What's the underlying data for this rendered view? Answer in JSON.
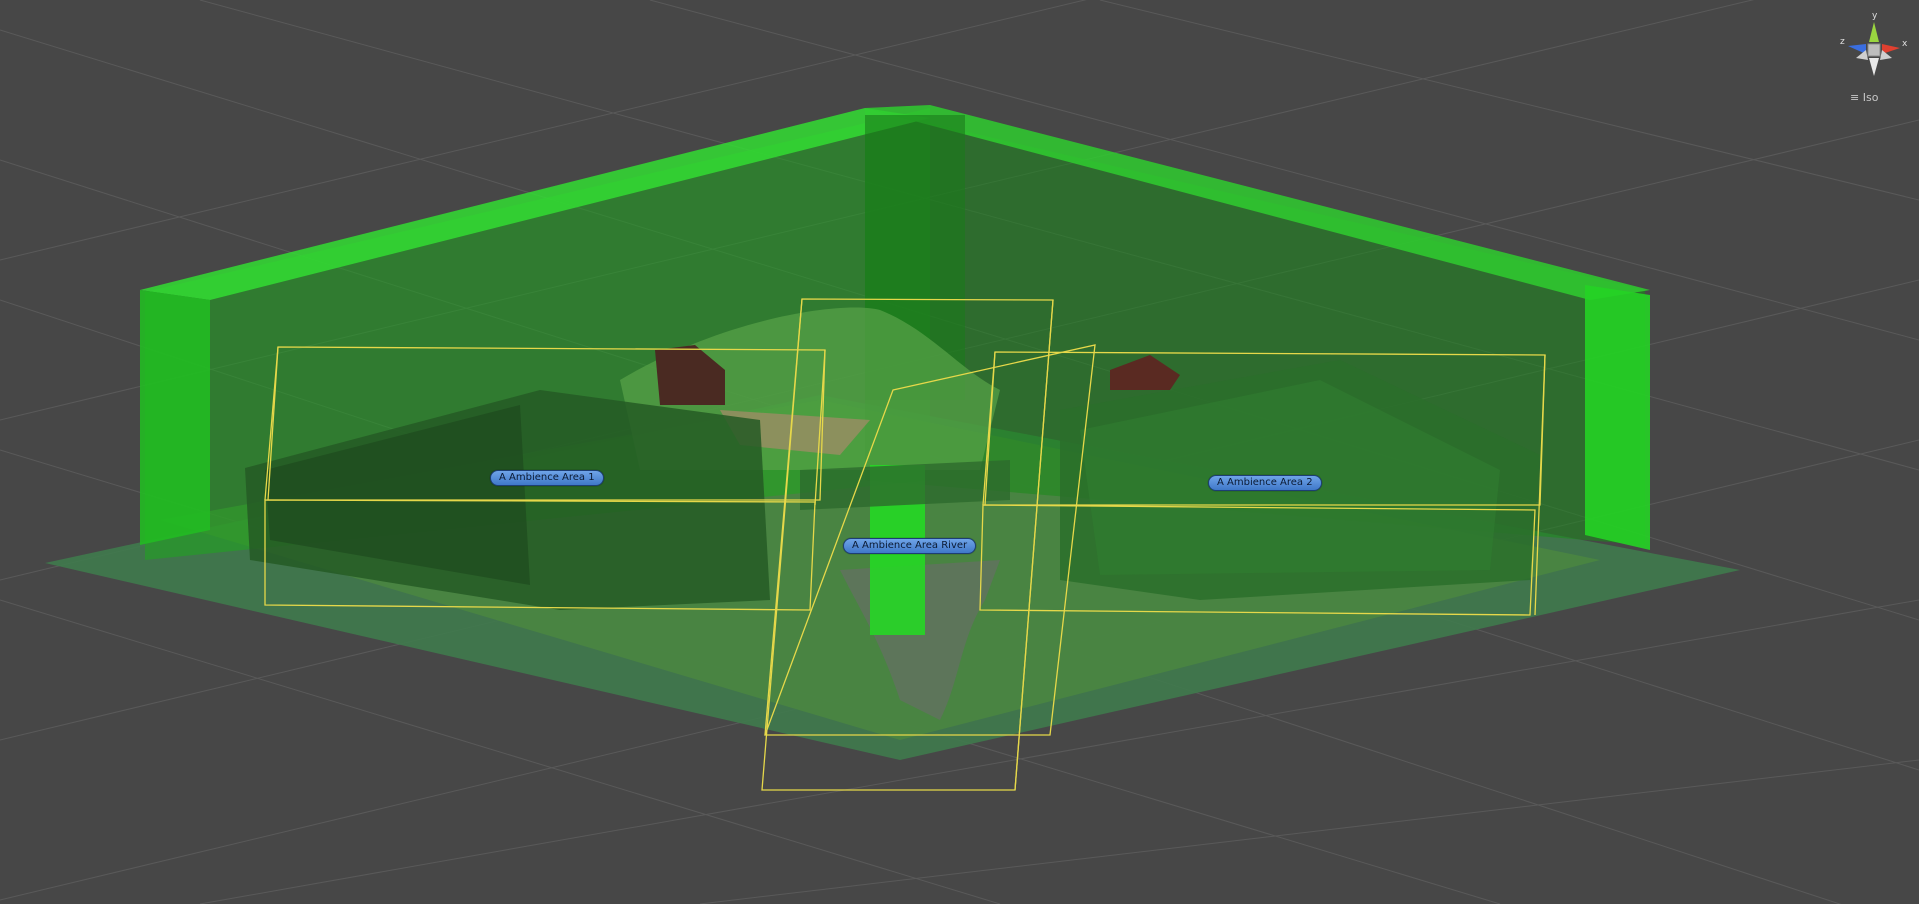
{
  "scene_view": {
    "projection_label": "Iso",
    "gizmo_axes": {
      "y": "y",
      "x": "x",
      "z": "z"
    },
    "colors": {
      "background": "#474747",
      "grid": "#5a5a5a",
      "volume_green": "#22ee22",
      "area_outline": "#e6d84a",
      "terrain": "#3f7f4a"
    }
  },
  "ambience_areas": [
    {
      "name": "A Ambience Area 1"
    },
    {
      "name": "A Ambience Area River"
    },
    {
      "name": "A Ambience Area 2"
    }
  ]
}
